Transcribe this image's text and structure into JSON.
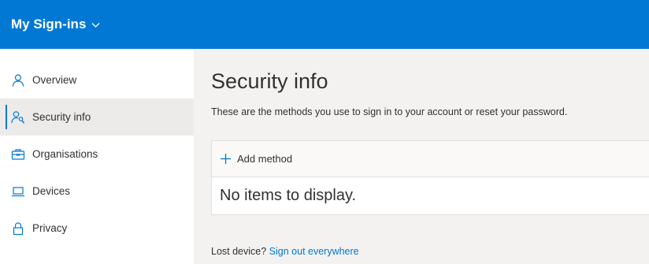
{
  "header": {
    "title": "My Sign-ins",
    "bg_color": "#0078d4",
    "menu_icon": "chevron-down-icon"
  },
  "sidebar": {
    "items": [
      {
        "id": "overview",
        "label": "Overview",
        "icon": "person-icon",
        "active": false
      },
      {
        "id": "security-info",
        "label": "Security info",
        "icon": "person-key-icon",
        "active": true
      },
      {
        "id": "organisations",
        "label": "Organisations",
        "icon": "briefcase-icon",
        "active": false
      },
      {
        "id": "devices",
        "label": "Devices",
        "icon": "laptop-icon",
        "active": false
      },
      {
        "id": "privacy",
        "label": "Privacy",
        "icon": "lock-icon",
        "active": false
      }
    ]
  },
  "main": {
    "title": "Security info",
    "description": "These are the methods you use to sign in to your account or reset your password.",
    "add_method_label": "Add method",
    "empty_message": "No items to display.",
    "lost_device_text": "Lost device?",
    "sign_out_link": "Sign out everywhere"
  },
  "colors": {
    "accent": "#0078d4",
    "main_bg": "#f3f2f1",
    "active_nav_bg": "#edebe9"
  }
}
